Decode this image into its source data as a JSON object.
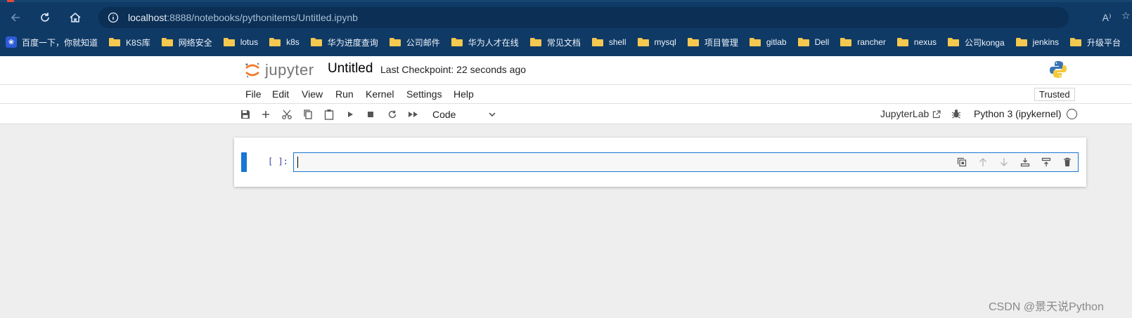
{
  "browser": {
    "address": {
      "host": "localhost",
      "path": ":8888/notebooks/pythonitems/Untitled.ipynb"
    },
    "read_aloud_label": "A⁾",
    "bookmarks": [
      {
        "label": "百度一下，你就知道",
        "icon": "baidu-icon"
      },
      {
        "label": "K8S库",
        "icon": "folder-icon"
      },
      {
        "label": "网络安全",
        "icon": "folder-icon"
      },
      {
        "label": "lotus",
        "icon": "folder-icon"
      },
      {
        "label": "k8s",
        "icon": "folder-icon"
      },
      {
        "label": "华为进度查询",
        "icon": "folder-icon"
      },
      {
        "label": "公司邮件",
        "icon": "folder-icon"
      },
      {
        "label": "华为人才在线",
        "icon": "folder-icon"
      },
      {
        "label": "常见文档",
        "icon": "folder-icon"
      },
      {
        "label": "shell",
        "icon": "folder-icon"
      },
      {
        "label": "mysql",
        "icon": "folder-icon"
      },
      {
        "label": "项目管理",
        "icon": "folder-icon"
      },
      {
        "label": "gitlab",
        "icon": "folder-icon"
      },
      {
        "label": "Dell",
        "icon": "folder-icon"
      },
      {
        "label": "rancher",
        "icon": "folder-icon"
      },
      {
        "label": "nexus",
        "icon": "folder-icon"
      },
      {
        "label": "公司konga",
        "icon": "folder-icon"
      },
      {
        "label": "jenkins",
        "icon": "folder-icon"
      },
      {
        "label": "升级平台",
        "icon": "folder-icon"
      }
    ]
  },
  "jupyter": {
    "logo_text": "jupyter",
    "notebook_title": "Untitled",
    "checkpoint": "Last Checkpoint: 22 seconds ago",
    "menu": [
      "File",
      "Edit",
      "View",
      "Run",
      "Kernel",
      "Settings",
      "Help"
    ],
    "trusted": "Trusted",
    "toolbar": {
      "buttons": [
        "save-icon",
        "add-cell-icon",
        "cut-icon",
        "copy-icon",
        "paste-icon",
        "run-icon",
        "stop-icon",
        "restart-icon",
        "fast-forward-icon"
      ],
      "cell_type": "Code",
      "jupyterlab_link": "JupyterLab",
      "kernel": "Python 3 (ipykernel)",
      "kernel_status": "idle"
    },
    "cell": {
      "prompt": "[ ]:",
      "source": "",
      "tools": [
        "duplicate-icon",
        "move-up-icon",
        "move-down-icon",
        "insert-below-icon",
        "insert-above-icon",
        "delete-icon"
      ]
    }
  },
  "watermark": "CSDN @景天说Python",
  "colors": {
    "browser_bg": "#0f3a66",
    "accent_blue": "#1976d2",
    "jupyter_orange": "#f37626",
    "page_bg": "#eeeeee"
  }
}
